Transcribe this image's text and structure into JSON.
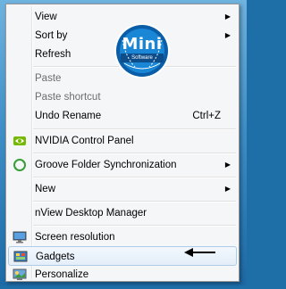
{
  "menu": {
    "items": [
      {
        "label": "View",
        "submenu": true
      },
      {
        "label": "Sort by",
        "submenu": true
      },
      {
        "label": "Refresh"
      },
      {
        "label": "Paste",
        "disabled": true
      },
      {
        "label": "Paste shortcut",
        "disabled": true
      },
      {
        "label": "Undo Rename",
        "shortcut": "Ctrl+Z"
      },
      {
        "label": "NVIDIA Control Panel",
        "icon": "nvidia-icon"
      },
      {
        "label": "Groove Folder Synchronization",
        "icon": "groove-sync-icon",
        "submenu": true
      },
      {
        "label": "New",
        "submenu": true
      },
      {
        "label": "nView Desktop Manager"
      },
      {
        "label": "Screen resolution",
        "icon": "monitor-icon"
      },
      {
        "label": "Gadgets",
        "icon": "gadgets-icon",
        "highlighted": true
      },
      {
        "label": "Personalize",
        "icon": "personalize-icon"
      }
    ]
  },
  "logo": {
    "title": "Mini",
    "subtitle": "Software"
  },
  "annotation": {
    "arrow": "left-arrow-icon"
  },
  "colors": {
    "menu_bg": "#f5f6f7",
    "highlight_border": "#aecbe8",
    "logo_blue": "#0d79c6",
    "desktop": "#3f8fc7"
  }
}
